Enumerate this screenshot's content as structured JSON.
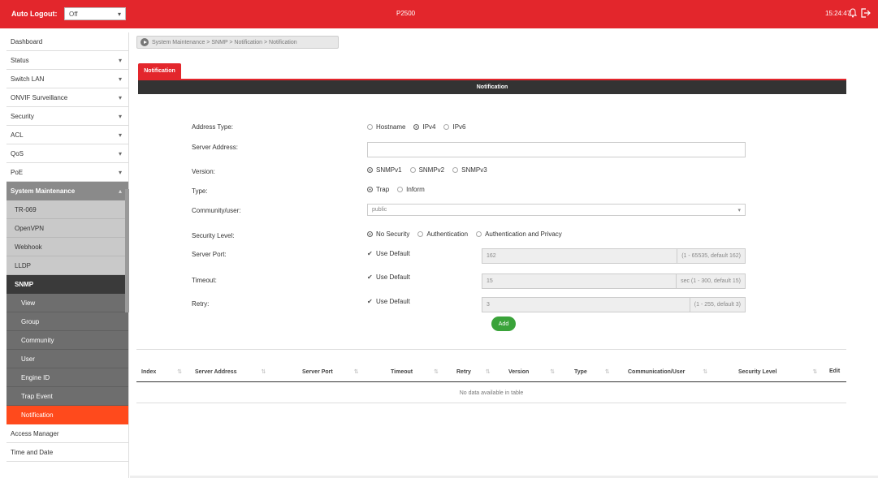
{
  "topbar": {
    "auto_logout_label": "Auto Logout:",
    "auto_logout_value": "Off",
    "brand": "",
    "model": "P2500",
    "clock": "15:24:47"
  },
  "sidebar": {
    "items": [
      {
        "label": "Dashboard",
        "caret": false
      },
      {
        "label": "Status",
        "caret": true
      },
      {
        "label": "Switch LAN",
        "caret": true
      },
      {
        "label": "ONVIF Surveillance",
        "caret": true
      },
      {
        "label": "Security",
        "caret": true
      },
      {
        "label": "ACL",
        "caret": true
      },
      {
        "label": "QoS",
        "caret": true
      },
      {
        "label": "PoE",
        "caret": true
      }
    ],
    "system_maintenance": "System Maintenance",
    "sub_items": [
      "TR-069",
      "OpenVPN",
      "Webhook",
      "LLDP"
    ],
    "snmp": "SNMP",
    "snmp_items": [
      "View",
      "Group",
      "Community",
      "User",
      "Engine ID",
      "Trap Event"
    ],
    "active_item": "Notification",
    "after_items": [
      "Access Manager",
      "Time and Date"
    ]
  },
  "breadcrumb": "System Maintenance > SNMP > Notification > Notification",
  "tab": {
    "label": "Notification"
  },
  "panel": {
    "header": "Notification"
  },
  "form": {
    "address_type": {
      "label": "Address Type:",
      "options": [
        "Hostname",
        "IPv4",
        "IPv6"
      ],
      "selected": "IPv4"
    },
    "server_address": {
      "label": "Server Address:",
      "value": ""
    },
    "version": {
      "label": "Version:",
      "options": [
        "SNMPv1",
        "SNMPv2",
        "SNMPv3"
      ],
      "selected": "SNMPv1"
    },
    "type": {
      "label": "Type:",
      "options": [
        "Trap",
        "Inform"
      ],
      "selected": "Trap"
    },
    "community_user": {
      "label": "Community/user:",
      "value": "public"
    },
    "security_level": {
      "label": "Security Level:",
      "options": [
        "No Security",
        "Authentication",
        "Authentication and Privacy"
      ],
      "selected": "No Security"
    },
    "server_port": {
      "label": "Server Port:",
      "use_default": "Use Default",
      "value": "162",
      "hint": "(1 - 65535, default 162)"
    },
    "timeout": {
      "label": "Timeout:",
      "use_default": "Use Default",
      "value": "15",
      "hint": "sec (1 - 300, default 15)"
    },
    "retry": {
      "label": "Retry:",
      "use_default": "Use Default",
      "value": "3",
      "hint": "(1 - 255, default 3)"
    },
    "add_button": "Add"
  },
  "table": {
    "columns": [
      "Index",
      "Server Address",
      "Server Port",
      "Timeout",
      "Retry",
      "Version",
      "Type",
      "Communication/User",
      "Security Level",
      "Edit"
    ],
    "empty_text": "No data available in table"
  },
  "colors": {
    "accent": "#e3262c",
    "active": "#ff4a1c",
    "add": "#3aa33a"
  }
}
